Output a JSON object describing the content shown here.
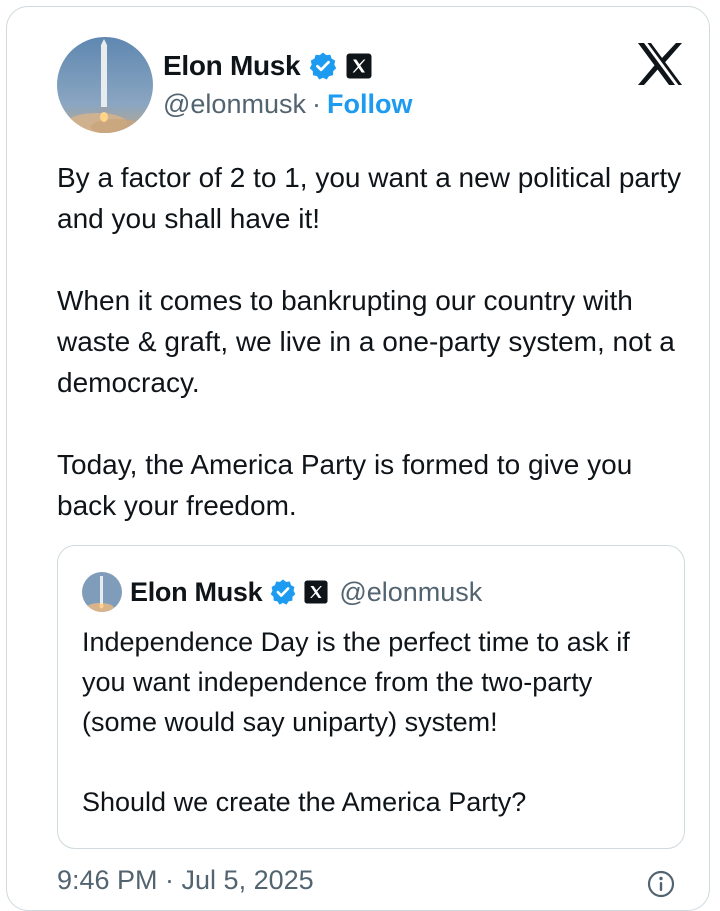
{
  "author": {
    "name": "Elon Musk",
    "handle": "@elonmusk",
    "separator": "·",
    "follow_label": "Follow"
  },
  "icons": {
    "verified": "verified-badge-icon",
    "affiliate": "x-affiliate-icon",
    "platform": "x-logo-icon",
    "info": "info-icon"
  },
  "colors": {
    "verified_blue": "#1d9bf0",
    "follow_blue": "#1d9bf0",
    "secondary_text": "#536471",
    "border": "#cfd9de"
  },
  "tweet": {
    "paragraphs": [
      "By a factor of 2 to 1, you want a new political party and you shall have it!",
      "When it comes to bankrupting our country with waste & graft, we live in a one-party system, not a democracy.",
      "Today, the America Party is formed to give you back your freedom."
    ]
  },
  "quote": {
    "name": "Elon Musk",
    "handle": "@elonmusk",
    "paragraphs": [
      "Independence Day is the perfect time to ask if you want independence from the two-party (some would say uniparty) system!",
      "Should we create the America Party?"
    ]
  },
  "timestamp": "9:46 PM · Jul 5, 2025"
}
